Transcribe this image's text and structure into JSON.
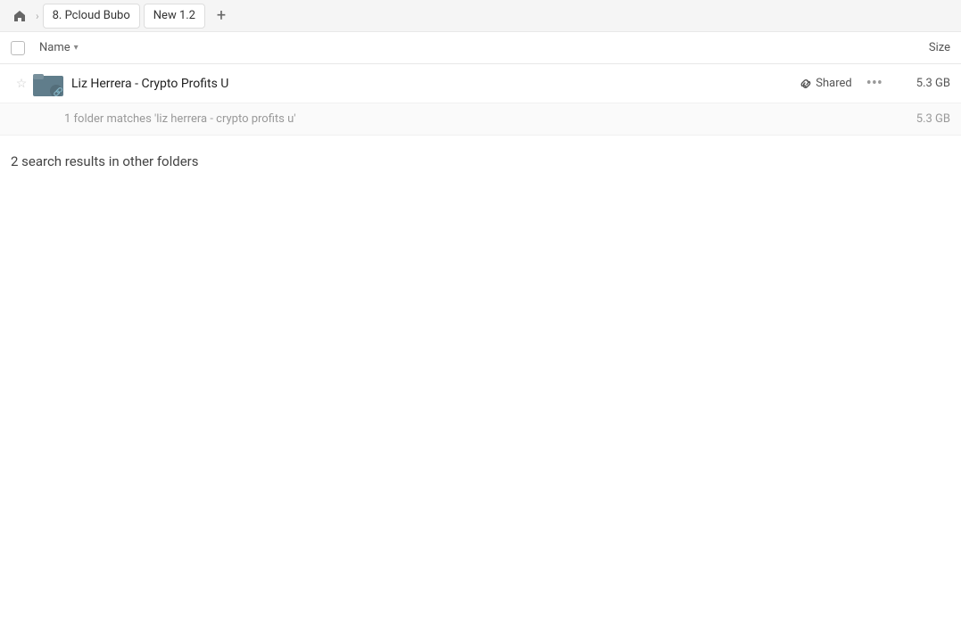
{
  "breadcrumb": {
    "home_icon": "🏠",
    "items": [
      {
        "label": "8. Pcloud Bubo",
        "id": "pcloud-bubo"
      },
      {
        "label": "New 1.2",
        "id": "new-1-2"
      }
    ],
    "add_icon": "+"
  },
  "columns": {
    "checkbox_col": "",
    "name_col": "Name",
    "sort_icon": "▾",
    "size_col": "Size"
  },
  "file_row": {
    "star_icon": "☆",
    "name": "Liz Herrera - Crypto Profits U",
    "shared_label": "Shared",
    "more_icon": "•••",
    "size": "5.3 GB"
  },
  "sub_info": {
    "text": "1 folder matches 'liz herrera - crypto profits u'",
    "size": "5.3 GB"
  },
  "other_folders": {
    "title": "2 search results in other folders"
  }
}
